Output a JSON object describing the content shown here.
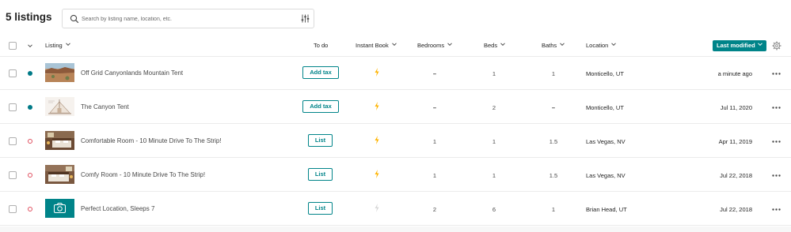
{
  "header": {
    "listing_count": "5 listings",
    "search_placeholder": "Search by listing name, location, etc."
  },
  "columns": {
    "listing": "Listing",
    "todo": "To do",
    "instant_book": "Instant Book",
    "bedrooms": "Bedrooms",
    "beds": "Beds",
    "baths": "Baths",
    "location": "Location",
    "sort": "Last modified"
  },
  "colors": {
    "accent": "#008489",
    "active_dot": "#007a87",
    "inactive_dot": "#e04f5f",
    "bolt_on": "#ffb400",
    "bolt_off": "#d8d8d8"
  },
  "rows": [
    {
      "title": "Off Grid Canyonlands Mountain Tent",
      "status": "listed",
      "todo": "Add tax",
      "instant_book": true,
      "bedrooms": "–",
      "beds": "1",
      "baths": "1",
      "location": "Monticello, UT",
      "modified": "a minute ago",
      "thumb": "desert-photo"
    },
    {
      "title": "The Canyon Tent",
      "status": "listed",
      "todo": "Add tax",
      "instant_book": true,
      "bedrooms": "–",
      "beds": "2",
      "baths": "–",
      "location": "Monticello, UT",
      "modified": "Jul 11, 2020",
      "thumb": "tent-sketch"
    },
    {
      "title": "Comfortable Room - 10 Minute Drive To The Strip!",
      "status": "unlisted",
      "todo": "List",
      "instant_book": true,
      "bedrooms": "1",
      "beds": "1",
      "baths": "1.5",
      "location": "Las Vegas, NV",
      "modified": "Apr 11, 2019",
      "thumb": "bedroom-photo"
    },
    {
      "title": "Comfy Room - 10 Minute Drive To The Strip!",
      "status": "unlisted",
      "todo": "List",
      "instant_book": true,
      "bedrooms": "1",
      "beds": "1",
      "baths": "1.5",
      "location": "Las Vegas, NV",
      "modified": "Jul 22, 2018",
      "thumb": "bedroom-photo"
    },
    {
      "title": "Perfect Location, Sleeps 7",
      "status": "unlisted",
      "todo": "List",
      "instant_book": false,
      "bedrooms": "2",
      "beds": "6",
      "baths": "1",
      "location": "Brian Head, UT",
      "modified": "Jul 22, 2018",
      "thumb": "camera-placeholder"
    }
  ]
}
